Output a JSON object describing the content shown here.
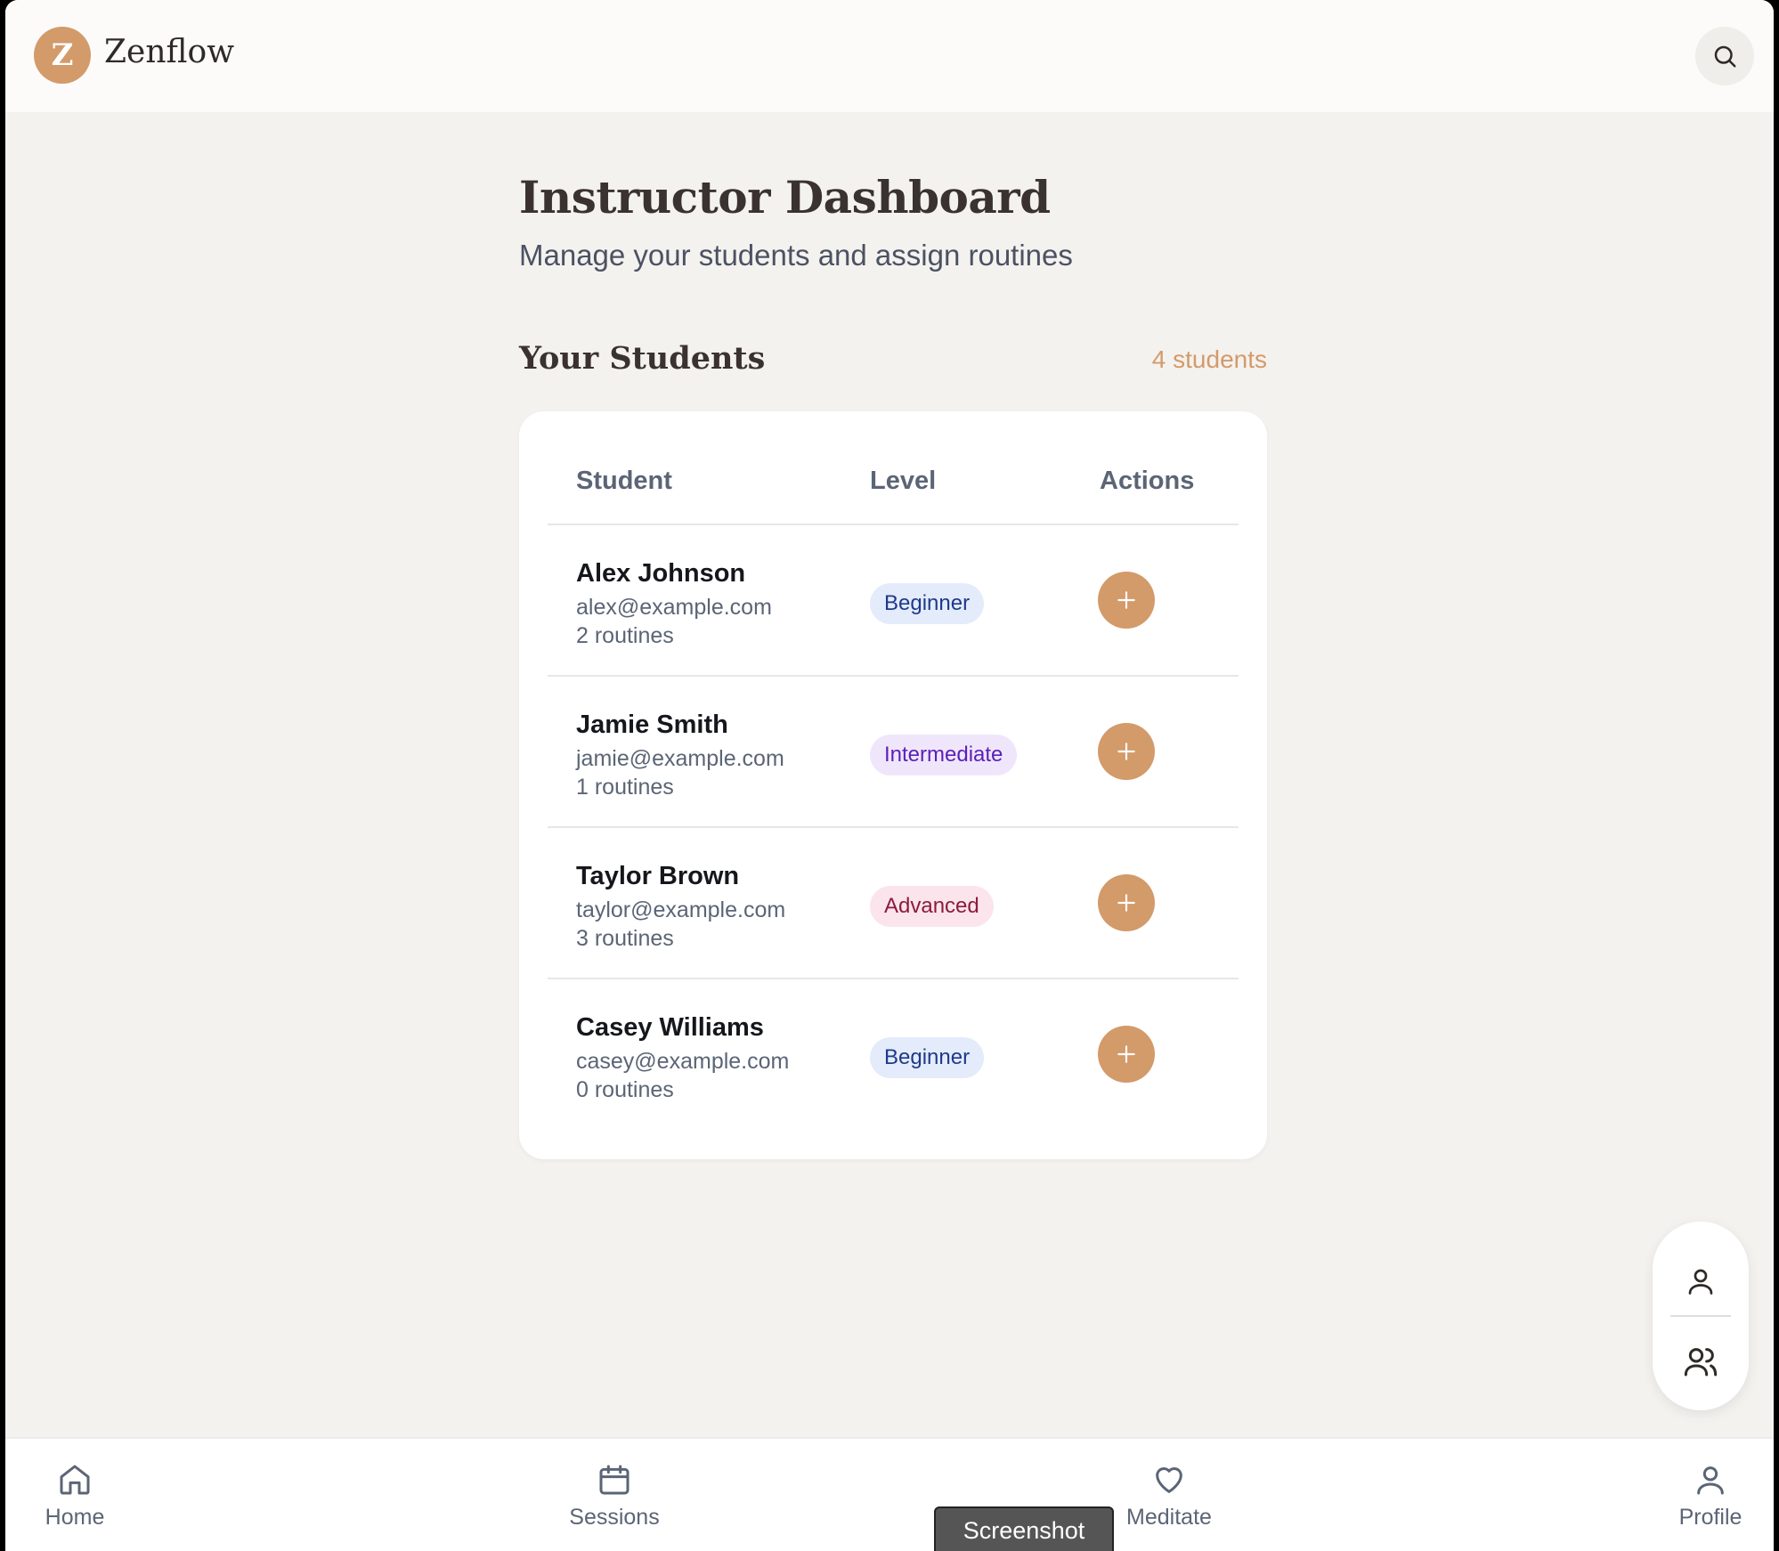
{
  "app": {
    "logo_letter": "Z",
    "name": "Zenflow"
  },
  "header": {
    "search_icon": "search-icon"
  },
  "main": {
    "title": "Instructor Dashboard",
    "subtitle": "Manage your students and assign routines",
    "section_title": "Your Students",
    "student_count": "4 students"
  },
  "table": {
    "headers": {
      "student": "Student",
      "level": "Level",
      "actions": "Actions"
    },
    "rows": [
      {
        "name": "Alex Johnson",
        "email": "alex@example.com",
        "routines": "2 routines",
        "level": "Beginner",
        "level_key": "beginner"
      },
      {
        "name": "Jamie Smith",
        "email": "jamie@example.com",
        "routines": "1 routines",
        "level": "Intermediate",
        "level_key": "intermediate"
      },
      {
        "name": "Taylor Brown",
        "email": "taylor@example.com",
        "routines": "3 routines",
        "level": "Advanced",
        "level_key": "advanced"
      },
      {
        "name": "Casey Williams",
        "email": "casey@example.com",
        "routines": "0 routines",
        "level": "Beginner",
        "level_key": "beginner"
      }
    ],
    "action_icon": "plus-icon"
  },
  "float_switch": {
    "items": [
      "user-icon",
      "users-icon"
    ]
  },
  "bottom_nav": {
    "items": [
      {
        "label": "Home",
        "icon": "home-icon"
      },
      {
        "label": "Sessions",
        "icon": "calendar-icon"
      },
      {
        "label": "Meditate",
        "icon": "heart-icon"
      },
      {
        "label": "Profile",
        "icon": "user-icon"
      }
    ]
  },
  "tooltip": {
    "text": "Screenshot"
  },
  "colors": {
    "accent": "#d39a6a",
    "background": "#f4f2ef",
    "beginner_bg": "#e4ebfa",
    "intermediate_bg": "#f0e6fc",
    "advanced_bg": "#fbe4ec"
  }
}
